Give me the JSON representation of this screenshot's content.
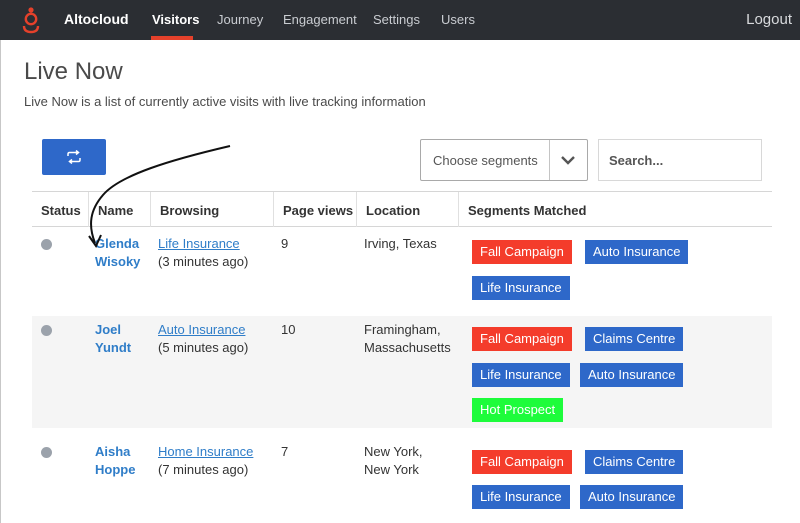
{
  "nav": {
    "brand": "Altocloud",
    "items": [
      "Visitors",
      "Journey",
      "Engagement",
      "Settings",
      "Users"
    ],
    "logout": "Logout"
  },
  "page": {
    "title": "Live Now",
    "description": "Live Now is a list of currently active visits with live tracking information"
  },
  "toolbar": {
    "segments_placeholder": "Choose segments",
    "search_placeholder": "Search..."
  },
  "table": {
    "headers": [
      "Status",
      "Name",
      "Browsing",
      "Page views",
      "Location",
      "Segments Matched"
    ],
    "rows": [
      {
        "first_name": "Glenda",
        "last_name": "Wisoky",
        "browsing_page": "Life Insurance",
        "browsing_time": "(3 minutes ago)",
        "page_views": "9",
        "location_line1": "Irving, Texas",
        "location_line2": "",
        "segments": [
          "Fall Campaign",
          "Auto Insurance",
          "Life Insurance"
        ]
      },
      {
        "first_name": "Joel",
        "last_name": "Yundt",
        "browsing_page": "Auto Insurance",
        "browsing_time": "(5 minutes ago)",
        "page_views": "10",
        "location_line1": "Framingham,",
        "location_line2": "Massachusetts",
        "segments": [
          "Fall Campaign",
          "Claims Centre",
          "Life Insurance",
          "Auto Insurance",
          "Hot Prospect"
        ]
      },
      {
        "first_name": "Aisha",
        "last_name": "Hoppe",
        "browsing_page": "Home Insurance",
        "browsing_time": "(7 minutes ago)",
        "page_views": "7",
        "location_line1": "New York,",
        "location_line2": "New York",
        "segments": [
          "Fall Campaign",
          "Claims Centre",
          "Life Insurance",
          "Auto Insurance"
        ]
      }
    ]
  },
  "colors": {
    "navbar": "#2b2e33",
    "accent": "#e5412b",
    "primary": "#2e68c9",
    "link": "#2f7dc8",
    "tag_red": "#f43c2b",
    "tag_green": "#1dfc3b"
  },
  "icons": {
    "logo": "genesys-logo-icon",
    "refresh": "refresh-icon",
    "dropdown": "chevron-down-icon",
    "status": "status-dot-icon",
    "annotation": "curved-arrow-annotation"
  }
}
